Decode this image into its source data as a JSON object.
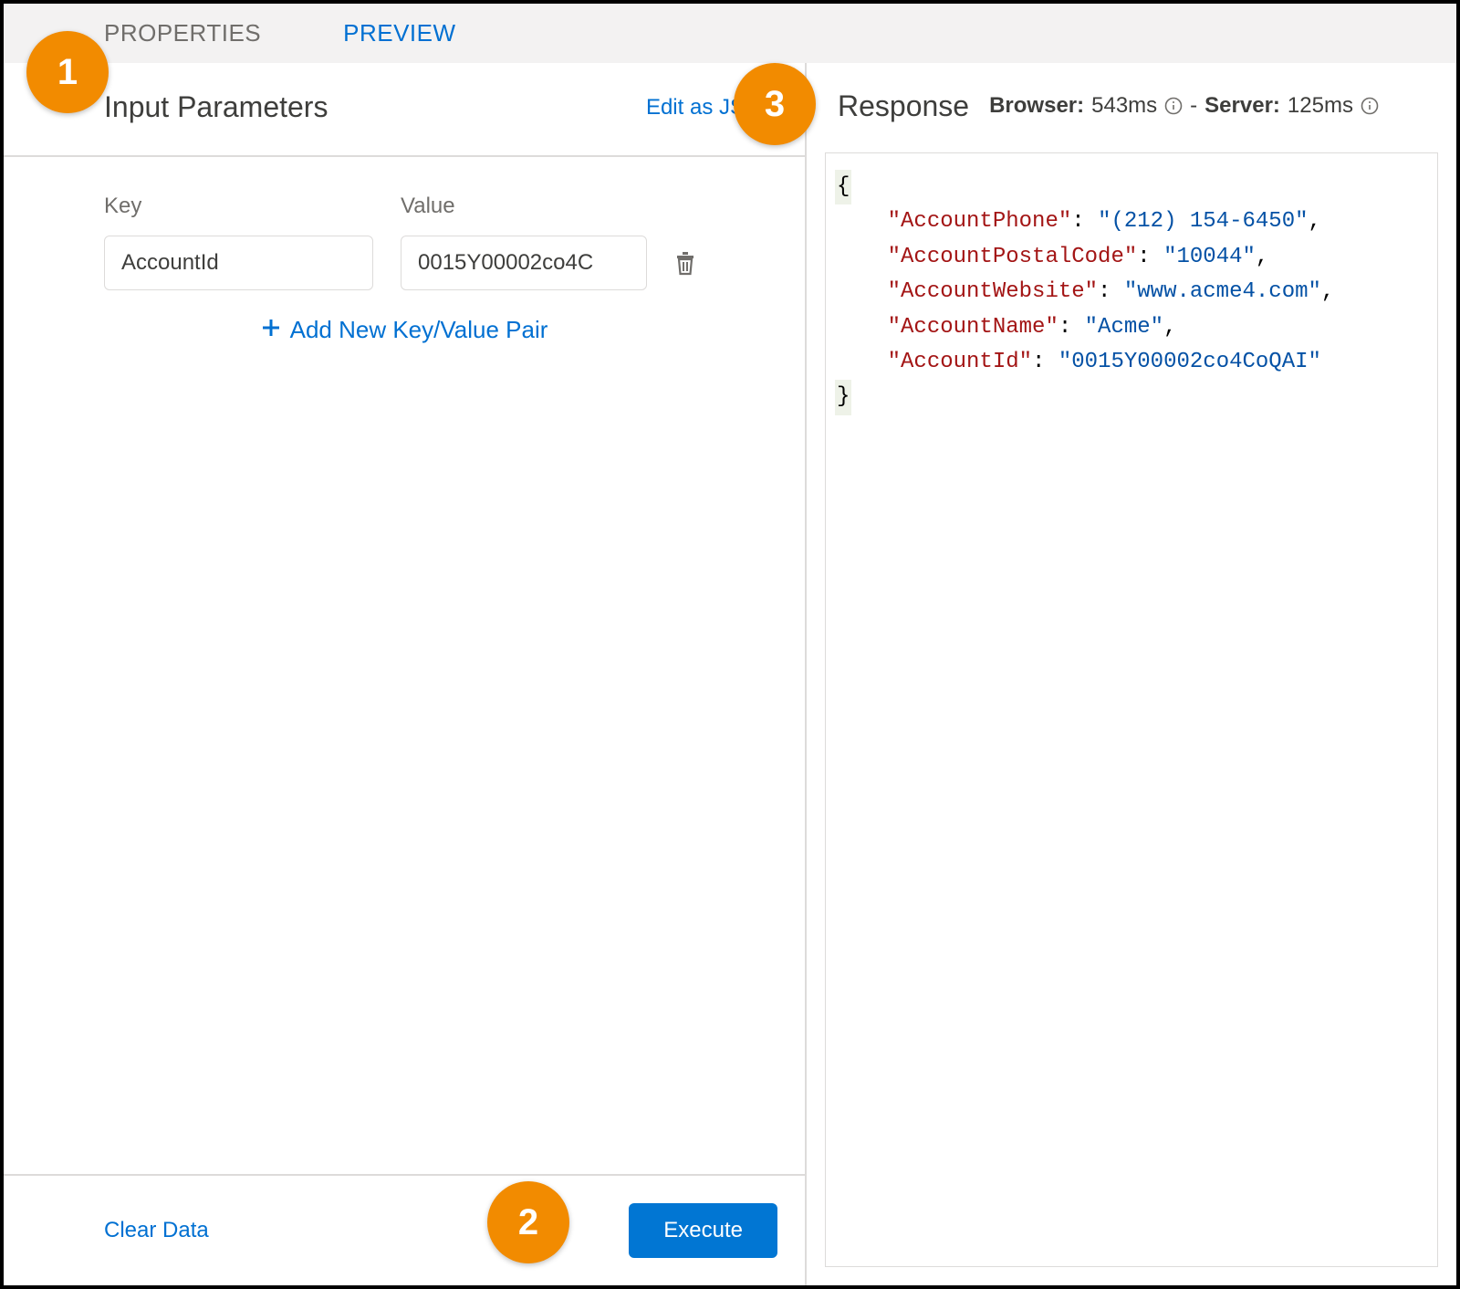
{
  "tabs": {
    "properties": "PROPERTIES",
    "preview": "PREVIEW"
  },
  "input_panel": {
    "title": "Input Parameters",
    "edit_json": "Edit as JSON",
    "key_label": "Key",
    "value_label": "Value",
    "row": {
      "key": "AccountId",
      "value": "0015Y00002co4C"
    },
    "add_row": "Add New Key/Value Pair",
    "clear": "Clear Data",
    "execute": "Execute"
  },
  "response_panel": {
    "title": "Response",
    "browser_label": "Browser:",
    "browser_value": "543ms",
    "separator": "-",
    "server_label": "Server:",
    "server_value": "125ms",
    "json": {
      "AccountPhone": "(212) 154-6450",
      "AccountPostalCode": "10044",
      "AccountWebsite": "www.acme4.com",
      "AccountName": "Acme",
      "AccountId": "0015Y00002co4CoQAI"
    }
  },
  "callouts": {
    "c1": "1",
    "c2": "2",
    "c3": "3"
  }
}
